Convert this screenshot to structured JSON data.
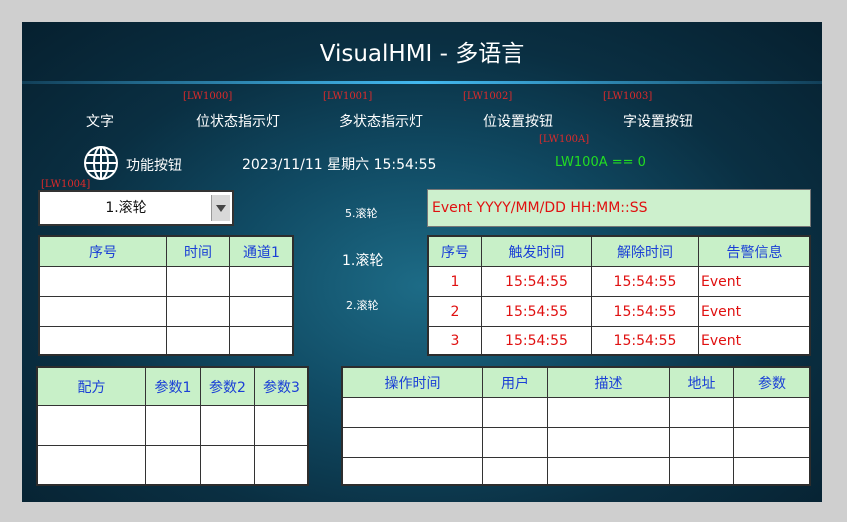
{
  "title": "VisualHMI - 多语言",
  "tags": [
    "[LW1000]",
    "[LW1001]",
    "[LW1002]",
    "[LW1003]",
    "[LW100A]",
    "[LW1004]"
  ],
  "labels": {
    "text": "文字",
    "bit_lamp": "位状态指示灯",
    "multi_lamp": "多状态指示灯",
    "bit_button": "位设置按钮",
    "word_button": "字设置按钮",
    "func_button": "功能按钮"
  },
  "datetime": "2023/11/11 星期六 15:54:55",
  "condition": "LW100A == 0",
  "combo": {
    "value": "1.滚轮"
  },
  "scroll": {
    "top": "5.滚轮",
    "middle": "1.滚轮",
    "bottom": "2.滚轮"
  },
  "event_format": "Event YYYY/MM/DD HH:MM::SS",
  "trend_table": {
    "headers": [
      "序号",
      "时间",
      "通道1"
    ]
  },
  "alarm_table": {
    "headers": [
      "序号",
      "触发时间",
      "解除时间",
      "告警信息"
    ],
    "rows": [
      [
        "1",
        "15:54:55",
        "15:54:55",
        "Event"
      ],
      [
        "2",
        "15:54:55",
        "15:54:55",
        "Event"
      ],
      [
        "3",
        "15:54:55",
        "15:54:55",
        "Event"
      ]
    ]
  },
  "recipe_table": {
    "headers": [
      "配方",
      "参数1",
      "参数2",
      "参数3"
    ]
  },
  "op_table": {
    "headers": [
      "操作时间",
      "用户",
      "描述",
      "地址",
      "参数"
    ]
  },
  "colors": {
    "header_bg": "#c8f0c8",
    "header_text": "#1a3fd6",
    "alarm_text": "#e01010",
    "tag_text": "#e02a2a",
    "status_green": "#22dd22"
  }
}
